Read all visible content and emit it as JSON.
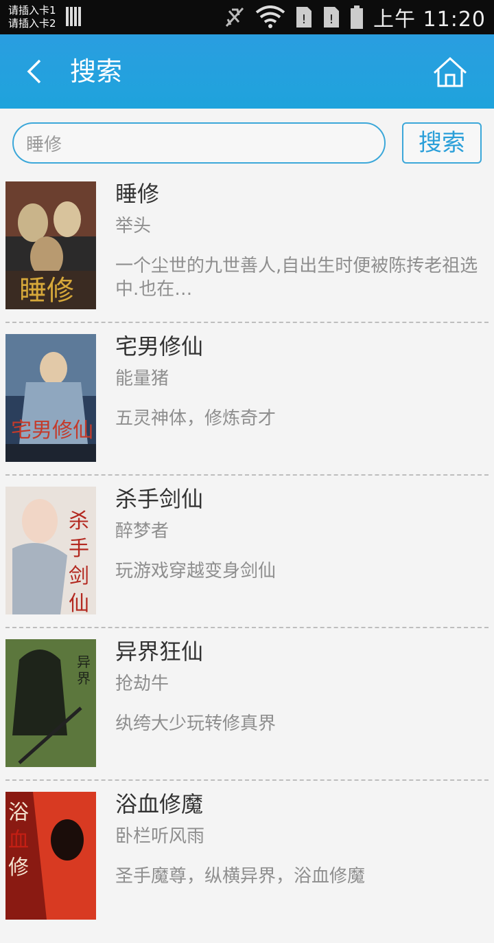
{
  "status_bar": {
    "sim1": "请插入卡1",
    "sim2": "请插入卡2",
    "time": "上午 11:20"
  },
  "header": {
    "title": "搜索",
    "back_icon": "chevron-left-icon",
    "home_icon": "home-icon"
  },
  "search": {
    "value": "睡修",
    "button_label": "搜索"
  },
  "books": [
    {
      "title": "睡修",
      "author": "举头",
      "desc": "一个尘世的九世善人,自出生时便被陈抟老祖选中.也在…",
      "cover_colors": [
        "#2b2a2a",
        "#6b3f2f",
        "#c9b48a"
      ]
    },
    {
      "title": "宅男修仙",
      "author": "能量猪",
      "desc": "五灵神体，修炼奇才",
      "cover_colors": [
        "#2b3f5c",
        "#8fa7bf",
        "#c43a2a"
      ]
    },
    {
      "title": "杀手剑仙",
      "author": "醉梦者",
      "desc": "玩游戏穿越变身剑仙",
      "cover_colors": [
        "#e9e2dc",
        "#a8b3c0",
        "#b3281f"
      ]
    },
    {
      "title": "异界狂仙",
      "author": "抢劫牛",
      "desc": "纨绔大少玩转修真界",
      "cover_colors": [
        "#8aa45a",
        "#3e5a2a",
        "#1e241a"
      ]
    },
    {
      "title": "浴血修魔",
      "author": "卧栏听风雨",
      "desc": "圣手魔尊，纵横异界，浴血修魔",
      "cover_colors": [
        "#8a1a12",
        "#d83a22",
        "#1b0d0a"
      ]
    }
  ]
}
